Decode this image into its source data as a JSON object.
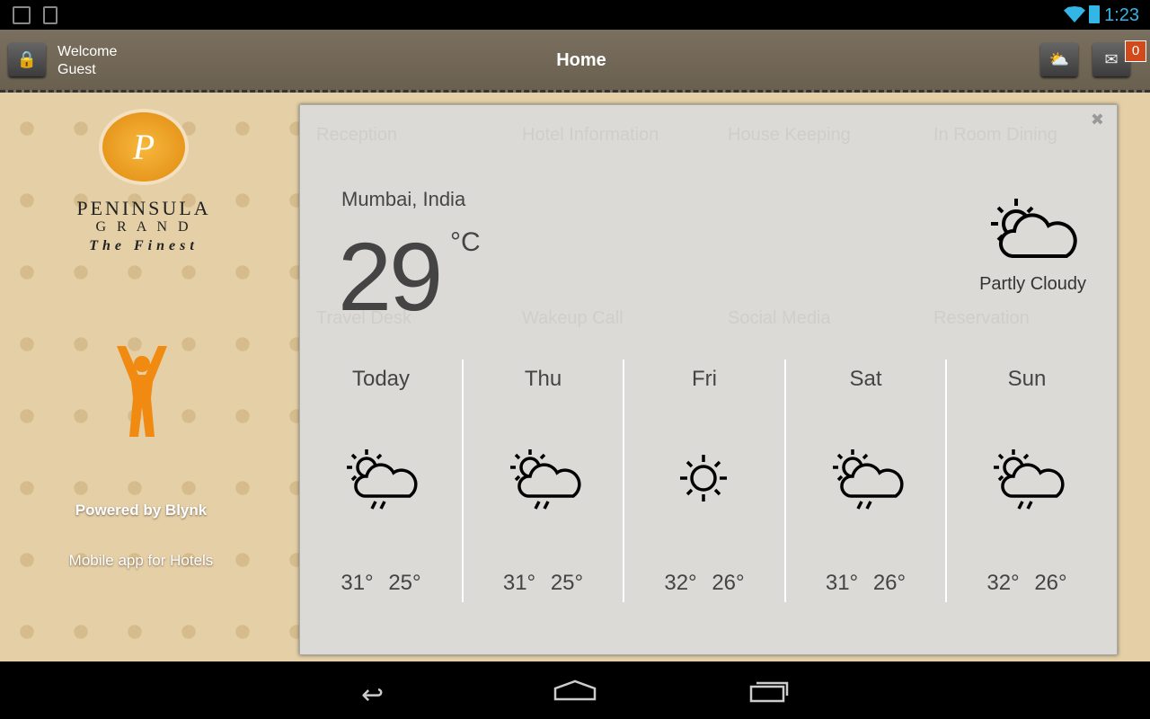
{
  "status_bar": {
    "time": "1:23",
    "icons": [
      "image-icon",
      "download-icon",
      "wifi-icon",
      "battery-icon"
    ]
  },
  "header": {
    "welcome_line1": "Welcome",
    "welcome_line2": "Guest",
    "title": "Home",
    "message_count": "0"
  },
  "sidebar": {
    "brand_name": "PENINSULA",
    "brand_sub": "G R A N D",
    "tagline": "The Finest",
    "logo_letter": "P",
    "powered_by": "Powered by Blynk",
    "subtitle": "Mobile app for Hotels"
  },
  "background_tiles": [
    "Reception",
    "Hotel Information",
    "House Keeping",
    "In Room Dining",
    "Travel Desk",
    "Wakeup Call",
    "Social Media",
    "Reservation"
  ],
  "weather": {
    "location": "Mumbai, India",
    "temperature": "29",
    "unit": "°C",
    "condition": "Partly Cloudy",
    "condition_icon": "partly-cloudy-icon",
    "forecast": [
      {
        "day": "Today",
        "icon": "rain-partly-cloudy-icon",
        "high": "31°",
        "low": "25°"
      },
      {
        "day": "Thu",
        "icon": "rain-partly-cloudy-icon",
        "high": "31°",
        "low": "25°"
      },
      {
        "day": "Fri",
        "icon": "sunny-icon",
        "high": "32°",
        "low": "26°"
      },
      {
        "day": "Sat",
        "icon": "rain-partly-cloudy-icon",
        "high": "31°",
        "low": "26°"
      },
      {
        "day": "Sun",
        "icon": "rain-partly-cloudy-icon",
        "high": "32°",
        "low": "26°"
      }
    ]
  },
  "colors": {
    "accent": "#33b5e5",
    "badge": "#d24a1c",
    "logo": "#f0a020"
  }
}
